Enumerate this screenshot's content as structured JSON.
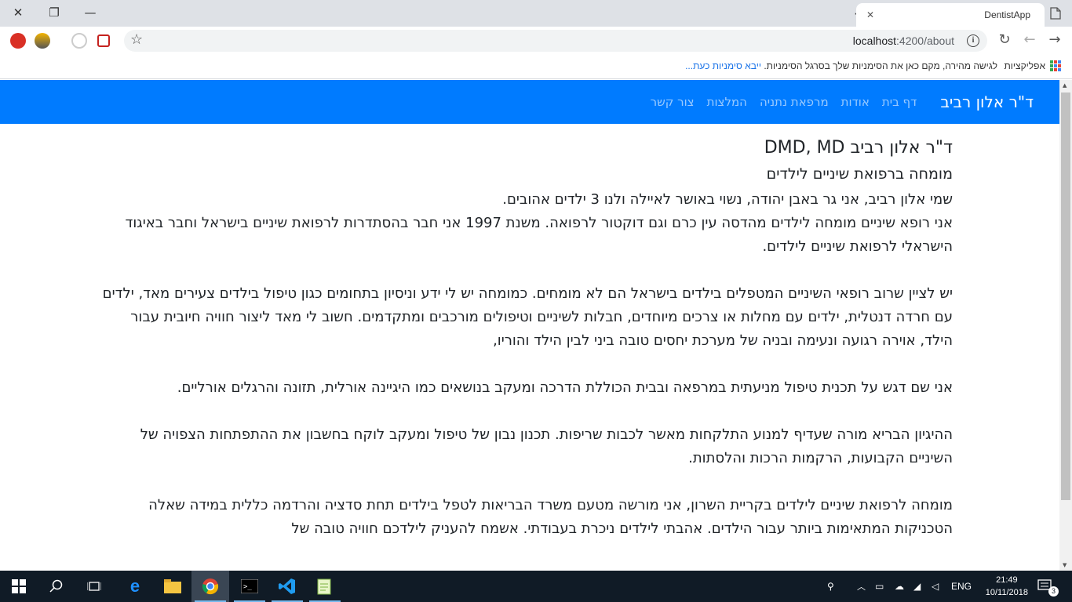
{
  "browser": {
    "tab_title": "DentistApp",
    "url_host": "localhost",
    "url_rest": ":4200/about",
    "apps_label": "אפליקציות",
    "bookmarks_hint": "לגישה מהירה, מקם כאן את הסימניות שלך בסרגל הסימניות.",
    "bookmarks_link": "ייבא סימניות כעת..."
  },
  "navbar": {
    "brand": "ד\"ר אלון רביב",
    "links": [
      "דף בית",
      "אודות",
      "מרפאת נתניה",
      "המלצות",
      "צור קשר"
    ]
  },
  "content": {
    "title": "ד\"ר אלון רביב DMD, MD",
    "subtitle": "מומחה ברפואת שיניים לילדים",
    "p1_line1": "שמי אלון רביב, אני גר באבן יהודה, נשוי באושר לאיילה ולנו 3 ילדים אהובים.",
    "p1_line2": "אני רופא שיניים מומחה לילדים מהדסה עין כרם וגם דוקטור לרפואה. משנת 1997 אני חבר בהסתדרות לרפואת שיניים בישראל וחבר באיגוד הישראלי לרפואת שיניים לילדים.",
    "p2": "יש לציין שרוב רופאי השיניים המטפלים בילדים בישראל הם לא מומחים. כמומחה יש לי ידע וניסיון בתחומים כגון טיפול בילדים צעירים מאד, ילדים עם חרדה דנטלית, ילדים עם מחלות או צרכים מיוחדים, חבלות לשיניים וטיפולים מורכבים ומתקדמים. חשוב לי מאד ליצור חוויה חיובית עבור הילד, אוירה רגועה ונעימה ובניה של מערכת יחסים טובה ביני לבין הילד והוריו,",
    "p3": "אני שם דגש על תכנית טיפול מניעתית במרפאה ובבית הכוללת הדרכה ומעקב בנושאים כמו היגיינה אורלית, תזונה והרגלים אורליים.",
    "p4": "ההיגיון הבריא מורה שעדיף למנוע התלקחות מאשר לכבות שריפות. תכנון נבון של טיפול ומעקב לוקח בחשבון את ההתפתחות הצפויה של השיניים הקבועות, הרקמות הרכות והלסתות.",
    "p5": "מומחה לרפואת שיניים לילדים בקריית השרון, אני מורשה מטעם משרד הבריאות לטפל בילדים תחת סדציה והרדמה כללית במידה שאלה הטכניקות המתאימות ביותר עבור הילדים. אהבתי לילדים ניכרת בעבודתי. אשמח להעניק לילדכם חוויה טובה של"
  },
  "taskbar": {
    "language": "ENG",
    "time": "21:49",
    "date": "10/11/2018",
    "notifications": "3"
  }
}
